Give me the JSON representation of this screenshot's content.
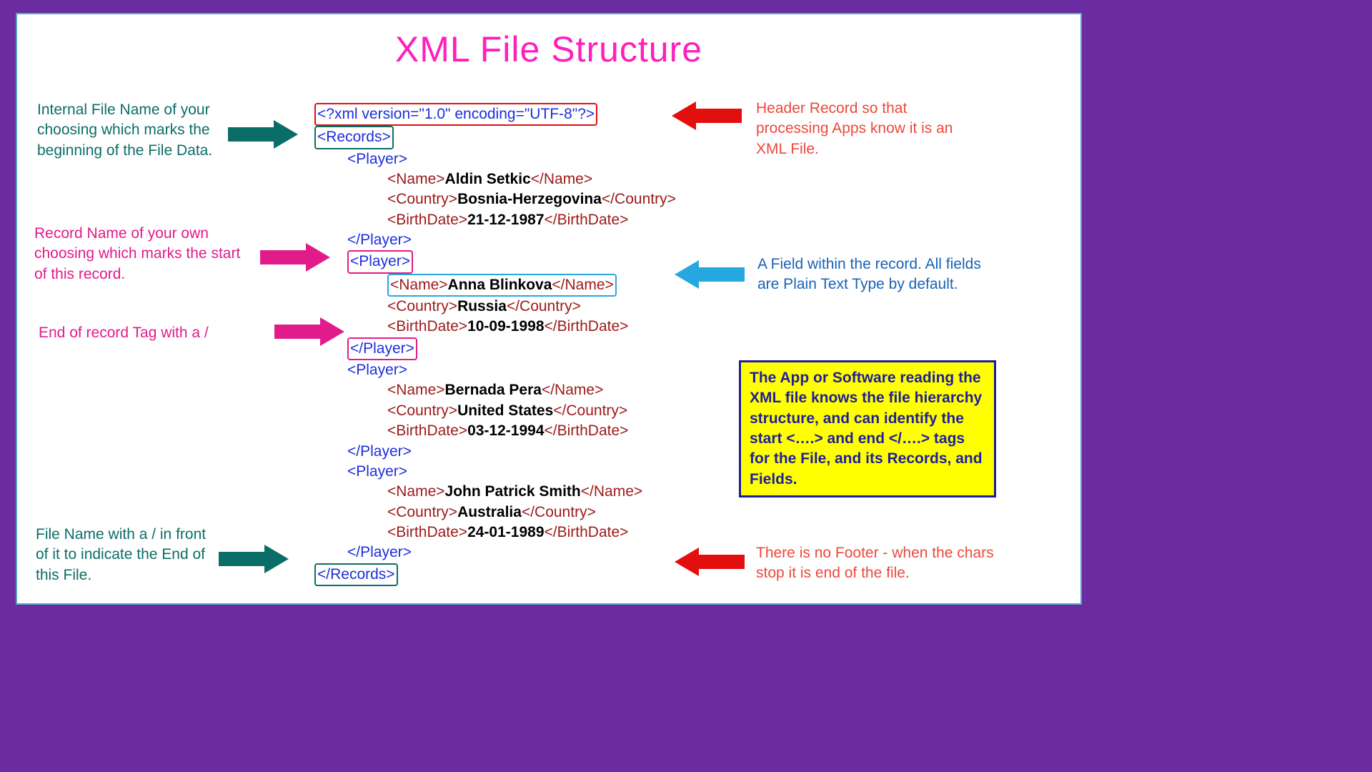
{
  "title": "XML File Structure",
  "labels": {
    "internal_file_name": "Internal File Name of your choosing which marks the beginning of the File Data.",
    "record_name": "Record Name of your own choosing which marks the start of this record.",
    "end_of_record": "End of record Tag with a /",
    "file_end": "File Name with a / in front of it to indicate the End of this File.",
    "header_record": "Header Record so that processing Apps know it is an XML File.",
    "field_in_record": "A Field within the record. All fields are Plain Text Type by default.",
    "no_footer": "There is no Footer - when the chars stop it is end of the file."
  },
  "note": "The App or Software reading the XML file knows the file hierarchy structure, and can identify the start <….> and end </….> tags for the File, and its Records, and Fields.",
  "xml": {
    "declaration": "<?xml version=\"1.0\" encoding=\"UTF-8\"?>",
    "records_open": "<Records>",
    "records_close": "</Records>",
    "player_open": "<Player>",
    "player_close": "</Player>",
    "name_open": "<Name>",
    "name_close": "</Name>",
    "country_open": "<Country>",
    "country_close": "</Country>",
    "birth_open": "<BirthDate>",
    "birth_close": "</BirthDate>",
    "players": [
      {
        "name": "Aldin Setkic",
        "country": "Bosnia-Herzegovina",
        "birth": "21-12-1987"
      },
      {
        "name": "Anna Blinkova",
        "country": "Russia",
        "birth": "10-09-1998"
      },
      {
        "name": "Bernada Pera",
        "country": "United States",
        "birth": "03-12-1994"
      },
      {
        "name": "John Patrick Smith",
        "country": "Australia",
        "birth": "24-01-1989"
      }
    ]
  },
  "colors": {
    "purple_frame": "#6B2BA1",
    "teal": "#0b6d67",
    "pink": "#e21b8b",
    "orange": "#eb493a",
    "blue": "#1b62b5",
    "cyan": "#26a7df",
    "red": "#e30e0e",
    "yellow": "#ffff00"
  },
  "chart_data": {
    "type": "table",
    "title": "XML File Structure",
    "columns": [
      "Name",
      "Country",
      "BirthDate"
    ],
    "rows": [
      [
        "Aldin Setkic",
        "Bosnia-Herzegovina",
        "21-12-1987"
      ],
      [
        "Anna Blinkova",
        "Russia",
        "10-09-1998"
      ],
      [
        "Bernada Pera",
        "United States",
        "03-12-1994"
      ],
      [
        "John Patrick Smith",
        "Australia",
        "24-01-1989"
      ]
    ]
  }
}
